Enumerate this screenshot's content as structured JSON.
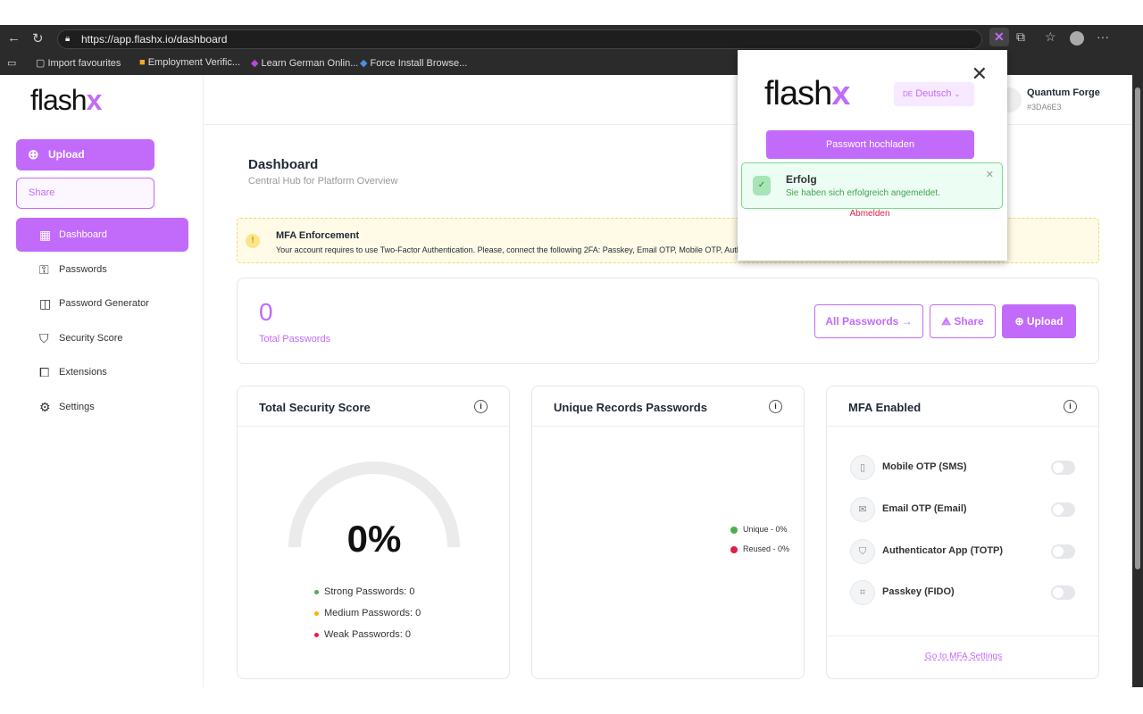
{
  "browser": {
    "url": "https://app.flashx.io/dashboard",
    "bookmarks": [
      "Import favourites",
      "Employment Verific...",
      "Learn German Onlin...",
      "Force Install Browse..."
    ]
  },
  "brand": {
    "logo_text": "flash",
    "logo_accent": "x",
    "accent": "#c26bfa"
  },
  "sidebar": {
    "upload": "Upload",
    "share": "Share",
    "items": [
      {
        "label": "Dashboard",
        "icon": "grid-icon"
      },
      {
        "label": "Passwords",
        "icon": "key-icon"
      },
      {
        "label": "Password Generator",
        "icon": "generator-icon"
      },
      {
        "label": "Security Score",
        "icon": "shield-icon"
      },
      {
        "label": "Extensions",
        "icon": "puzzle-icon"
      },
      {
        "label": "Settings",
        "icon": "gear-icon"
      }
    ]
  },
  "user": {
    "name": "Quantum Forge",
    "id": "#3DA6E3"
  },
  "header": {
    "title": "Dashboard",
    "subtitle": "Central Hub for Platform Overview"
  },
  "alert": {
    "title": "MFA Enforcement",
    "text": "Your account requires to use Two-Factor Authentication. Please, connect the following 2FA: Passkey, Email OTP, Mobile OTP, Authe"
  },
  "totals": {
    "count": "0",
    "label": "Total Passwords",
    "all_passwords": "All Passwords",
    "share": "Share",
    "upload": "Upload"
  },
  "security": {
    "title": "Total Security Score",
    "percent": "0%",
    "value": 0,
    "strong": "Strong Passwords: 0",
    "medium": "Medium Passwords: 0",
    "weak": "Weak Passwords: 0"
  },
  "unique": {
    "title": "Unique Records Passwords",
    "unique": "Unique - 0%",
    "reused": "Reused - 0%"
  },
  "mfa": {
    "title": "MFA Enabled",
    "items": [
      {
        "label": "Mobile OTP (SMS)",
        "enabled": false
      },
      {
        "label": "Email OTP (Email)",
        "enabled": false
      },
      {
        "label": "Authenticator App (TOTP)",
        "enabled": false
      },
      {
        "label": "Passkey (FIDO)",
        "enabled": false
      }
    ],
    "link": "Go to MFA Settings"
  },
  "popup": {
    "lang_code": "DE",
    "lang": "Deutsch",
    "upload": "Passwort hochladen",
    "toast_title": "Erfolg",
    "toast_text": "Sie haben sich erfolgreich angemeldet.",
    "logout": "Abmelden"
  }
}
